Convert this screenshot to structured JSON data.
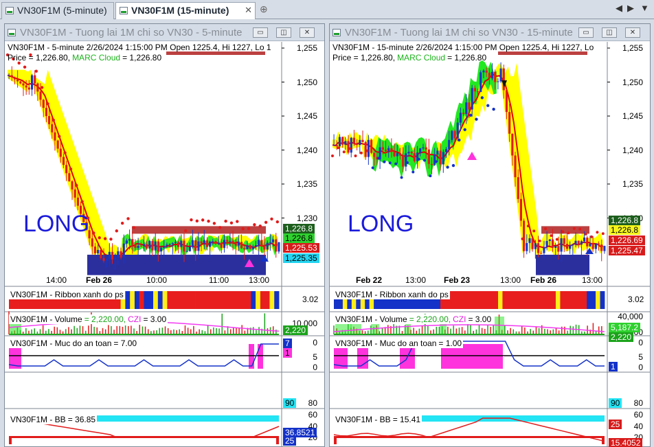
{
  "tabs": [
    {
      "label": "VN30F1M (5-minute)"
    },
    {
      "label": "VN30F1M (15-minute)"
    }
  ],
  "close_glyph": "✕",
  "plus_glyph": "⊕",
  "nav": {
    "left": "◀",
    "right": "▶",
    "menu": "▼"
  },
  "win_buttons": {
    "min": "▭",
    "restore": "◫",
    "close": "✕"
  },
  "windows": [
    {
      "title": "VN30F1M - Tuong lai 1M chi so VN30 - 5-minute",
      "header1": "VN30F1M - 5-minute 2/26/2024 1:15:00 PM Open 1225.4, Hi 1227, Lo 1",
      "price_label": "Price = 1,226.80,",
      "cloud_label": "MARC Cloud",
      "cloud_value": "= 1,226.80",
      "annotation": "LONG",
      "price_ticks": [
        "1,255",
        "1,250",
        "1,245",
        "1,240",
        "1,235",
        "1,230"
      ],
      "price_tags": [
        {
          "text": "1,226.8",
          "bg": "#1d5e1d",
          "fg": "#ffffff"
        },
        {
          "text": "1,226.8",
          "bg": "#2ed12e",
          "fg": "#000000"
        },
        {
          "text": "1,225.53",
          "bg": "#d81b1b",
          "fg": "#ffffff"
        },
        {
          "text": "1,225.35",
          "bg": "#22d4f0",
          "fg": "#000000"
        }
      ],
      "time_labels": [
        "14:00",
        "Feb 26",
        "10:00",
        "11:00",
        "13:00"
      ],
      "ribbon_title": "VN30F1M - Ribbon xanh do ps",
      "ribbon_value": "3.02",
      "volume_title": "VN30F1M - Volume",
      "volume_value": "= 2,220.00,",
      "czi_label": "CZI",
      "czi_value": "= 3.00",
      "volume_ticks": [
        "10,000",
        "0"
      ],
      "volume_tags": [
        "2,220"
      ],
      "safe_title": "VN30F1M - Muc do an toan",
      "safe_value": "= 7.00",
      "safe_ticks": [
        "5",
        "0"
      ],
      "safe_tags": [
        "7",
        "1"
      ],
      "bb_title": "VN30F1M - BB",
      "bb_value": "= 36.85",
      "bb_ticks": [
        "80",
        "60",
        "40",
        "20"
      ],
      "bb_tags": [
        "90",
        "36.8521",
        "25"
      ]
    },
    {
      "title": "VN30F1M - Tuong lai 1M chi so VN30 - 15-minute",
      "header1": "VN30F1M - 15-minute 2/26/2024 1:15:00 PM Open 1225.4, Hi 1227, Lo",
      "price_label": "Price = 1,226.80,",
      "cloud_label": "MARC Cloud",
      "cloud_value": "= 1,226.80",
      "annotation": "LONG",
      "price_ticks": [
        "1,255",
        "1,250",
        "1,245",
        "1,240",
        "1,235",
        "1,230"
      ],
      "price_tags": [
        {
          "text": "1,226.8",
          "bg": "#1d5e1d",
          "fg": "#ffffff"
        },
        {
          "text": "1,226.8",
          "bg": "#f5f51a",
          "fg": "#000000"
        },
        {
          "text": "1,226.69",
          "bg": "#d81b1b",
          "fg": "#ffffff"
        },
        {
          "text": "1,225.47",
          "bg": "#d81b1b",
          "fg": "#ffffff"
        }
      ],
      "time_labels": [
        "Feb 22",
        "13:00",
        "Feb 23",
        "13:00",
        "Feb 26",
        "13:00"
      ],
      "ribbon_title": "VN30F1M - Ribbon xanh do ps",
      "ribbon_value": "3.02",
      "volume_title": "VN30F1M - Volume",
      "volume_value": "= 2,220.00,",
      "czi_label": "CZI",
      "czi_value": "= 3.00",
      "volume_ticks": [
        "40,000",
        "20,000",
        "0"
      ],
      "volume_tags": [
        "5,187.2",
        "2,220"
      ],
      "safe_title": "VN30F1M - Muc do an toan",
      "safe_value": "= 1.00",
      "safe_ticks": [
        "5",
        "0"
      ],
      "safe_tags": [
        "1"
      ],
      "bb_title": "VN30F1M - BB",
      "bb_value": "= 15.41",
      "bb_ticks": [
        "80",
        "60",
        "40",
        "20"
      ],
      "bb_tags": [
        "90",
        "25",
        "15.4052"
      ]
    }
  ],
  "colors": {
    "accent_blue": "#1a1adb",
    "ribbon_blue": "#1432c8",
    "ribbon_red": "#e81e1e",
    "ribbon_yellow": "#ffee1a",
    "cloud_yellow": "#ffff00",
    "cloud_green": "#22e822",
    "magenta": "#ff33dd",
    "cyan": "#22e4f4"
  }
}
